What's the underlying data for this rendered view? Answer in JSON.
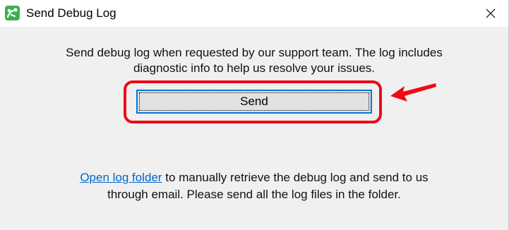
{
  "window": {
    "title": "Send Debug Log",
    "app_icon": "green-app-icon",
    "close_icon": "close-icon"
  },
  "message": {
    "line1": "Send debug log when requested by our support team. The log includes",
    "line2": "diagnostic info to help us resolve your issues."
  },
  "send_button": {
    "label": "Send"
  },
  "annotation": {
    "highlight_color": "#ee0a17",
    "arrow_icon": "red-arrow-icon"
  },
  "footer": {
    "link_text": "Open log folder",
    "line1_rest": " to manually retrieve the debug log and send to us",
    "line2": "through email. Please send all the log files in the folder.",
    "link_color": "#0066cc"
  }
}
